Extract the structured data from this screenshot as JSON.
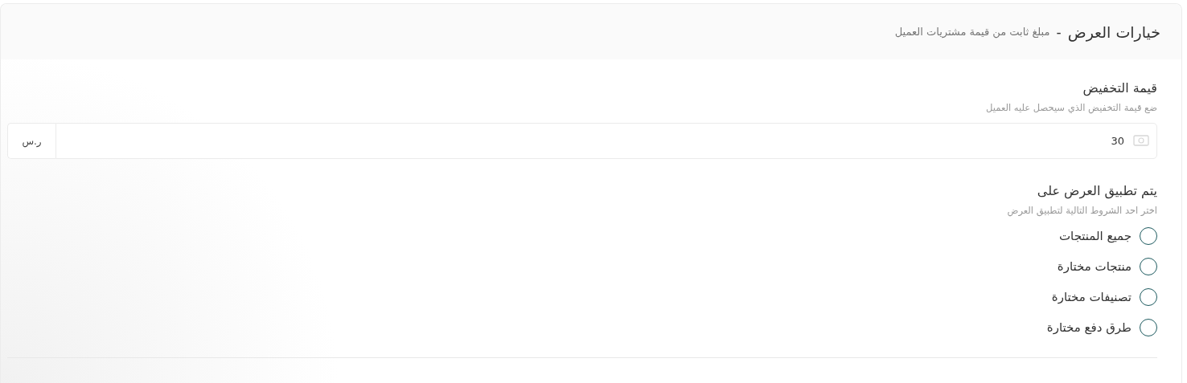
{
  "header": {
    "title": "خيارات العرض",
    "separator": "-",
    "subtitle": "مبلغ ثابت من قيمة مشتريات العميل"
  },
  "discount": {
    "label": "قيمة التخفيض",
    "hint": "ضع قيمة التخفيض الذي سيحصل عليه العميل",
    "value": "30",
    "currency": "ر.س"
  },
  "apply_to": {
    "label": "يتم تطبيق العرض على",
    "hint": "اختر احد الشروط التالية لتطبيق العرض",
    "options": [
      {
        "label": "جميع المنتجات",
        "selected": false
      },
      {
        "label": "منتجات مختارة",
        "selected": false
      },
      {
        "label": "تصنيفات مختارة",
        "selected": false
      },
      {
        "label": "طرق دفع مختارة",
        "selected": false
      }
    ]
  }
}
